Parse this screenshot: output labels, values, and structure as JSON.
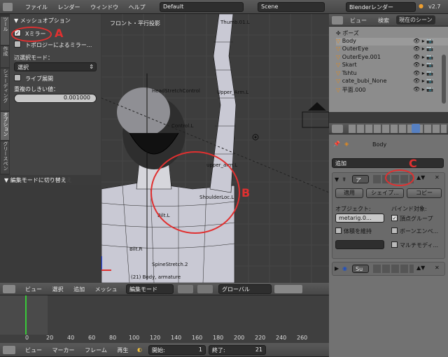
{
  "topbar": {
    "menus": [
      "ファイル",
      "レンダー",
      "ウィンドウ",
      "ヘルプ"
    ],
    "screen": "Default",
    "scene": "Scene",
    "engine": "Blenderレンダー",
    "version": "v2.7"
  },
  "toolshelf": {
    "section_title": "▼ メッシュオプション",
    "x_mirror": "Xミラー",
    "topology_mirror": "トポロジーによるミラー...",
    "select_mode_label": "辺選択モード：",
    "select_mode_value": "選択",
    "live_unwrap": "ライブ展開",
    "threshold_label": "重複のしきい値：",
    "threshold_value": "0.001000",
    "toggle_edit_mode": "▼ 編集モードに切り替え",
    "tabs": [
      "ツール",
      "作成",
      "シェーディング",
      "オプション",
      "グリースペン"
    ]
  },
  "viewport": {
    "view_label": "フロント・平行投影",
    "bone_labels": [
      "Upper_Arm.L",
      "upper_arm.L",
      "HeadStretchControl",
      "ShoulderLoc.L",
      "Bilt.L",
      "Bilt.R",
      "SpineStretch.2",
      "Thumb.01.L",
      "Control.L"
    ],
    "status": "(21) Body, armature"
  },
  "annotations": {
    "a": "A",
    "b": "B",
    "c": "C"
  },
  "viewport_header": {
    "items": [
      "ビュー",
      "選択",
      "追加",
      "メッシュ"
    ],
    "mode": "編集モード",
    "pivot": "グローバル"
  },
  "timeline": {
    "ticks": [
      "0",
      "20",
      "40",
      "60",
      "80",
      "100",
      "120",
      "140",
      "160",
      "180",
      "200",
      "220",
      "240",
      "260"
    ],
    "menus": [
      "ビュー",
      "マーカー",
      "フレーム",
      "再生"
    ],
    "start_label": "開始:",
    "start_value": "1",
    "end_label": "終了:",
    "end_value": "21"
  },
  "outliner": {
    "tabs": [
      "ビュー",
      "検索",
      "現在のシーン"
    ],
    "items": [
      "ポーズ",
      "Body",
      "OuterEye",
      "OuterEye.001",
      "Skart",
      "Tshtu",
      "cate_bubi_None",
      "平面.000"
    ]
  },
  "properties": {
    "breadcrumb": "Body",
    "add_label": "追加",
    "modifier_name": "ア",
    "apply": "適用",
    "shape": "シェイプ...",
    "copy": "コピー",
    "object_label": "オブジェクト:",
    "object_value": "metarig.0...",
    "preserve_volume": "体積を維持",
    "bind_to": "バインド対象:",
    "vertex_groups": "頂点グループ",
    "bone_envelopes": "ボーンエンベ...",
    "multi_modifier": "マルチモディ...",
    "modifier2_name": "Su"
  },
  "colors": {
    "accent_red": "#e03030",
    "panel": "#727272",
    "selected_tab": "#5680c2"
  }
}
